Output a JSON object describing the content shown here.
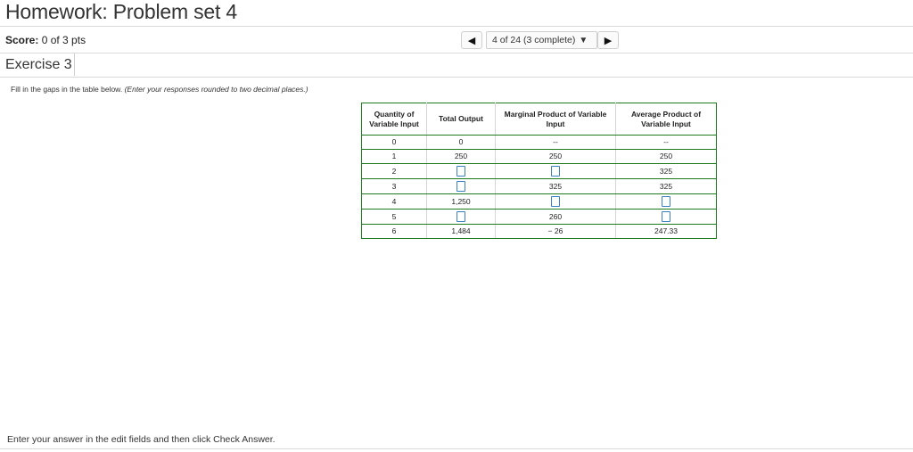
{
  "header": {
    "title": "Homework: Problem set 4"
  },
  "score": {
    "label": "Score:",
    "value": "0 of 3 pts"
  },
  "navigation": {
    "prev_icon": "triangle-left-icon",
    "position_text": "4 of 24 (3 complete)",
    "dropdown_icon": "caret-down-icon",
    "next_icon": "triangle-right-icon"
  },
  "exercise": {
    "tab_label": "Exercise 3"
  },
  "instructions": {
    "text": "Fill in the gaps in the table below.",
    "hint": "(Enter your responses rounded to two decimal places.)"
  },
  "table": {
    "headers": [
      "Quantity of Variable Input",
      "Total Output",
      "Marginal Product of Variable Input",
      "Average Product of Variable Input"
    ],
    "rows": [
      [
        "0",
        "0",
        "--",
        "--"
      ],
      [
        "1",
        "250",
        "250",
        "250"
      ],
      [
        "2",
        "",
        "",
        "325"
      ],
      [
        "3",
        "",
        "325",
        "325"
      ],
      [
        "4",
        "1,250",
        "",
        ""
      ],
      [
        "5",
        "",
        "260",
        ""
      ],
      [
        "6",
        "1,484",
        "− 26",
        "247.33"
      ]
    ]
  },
  "footer": {
    "text": "Enter your answer in the edit fields and then click Check Answer."
  }
}
